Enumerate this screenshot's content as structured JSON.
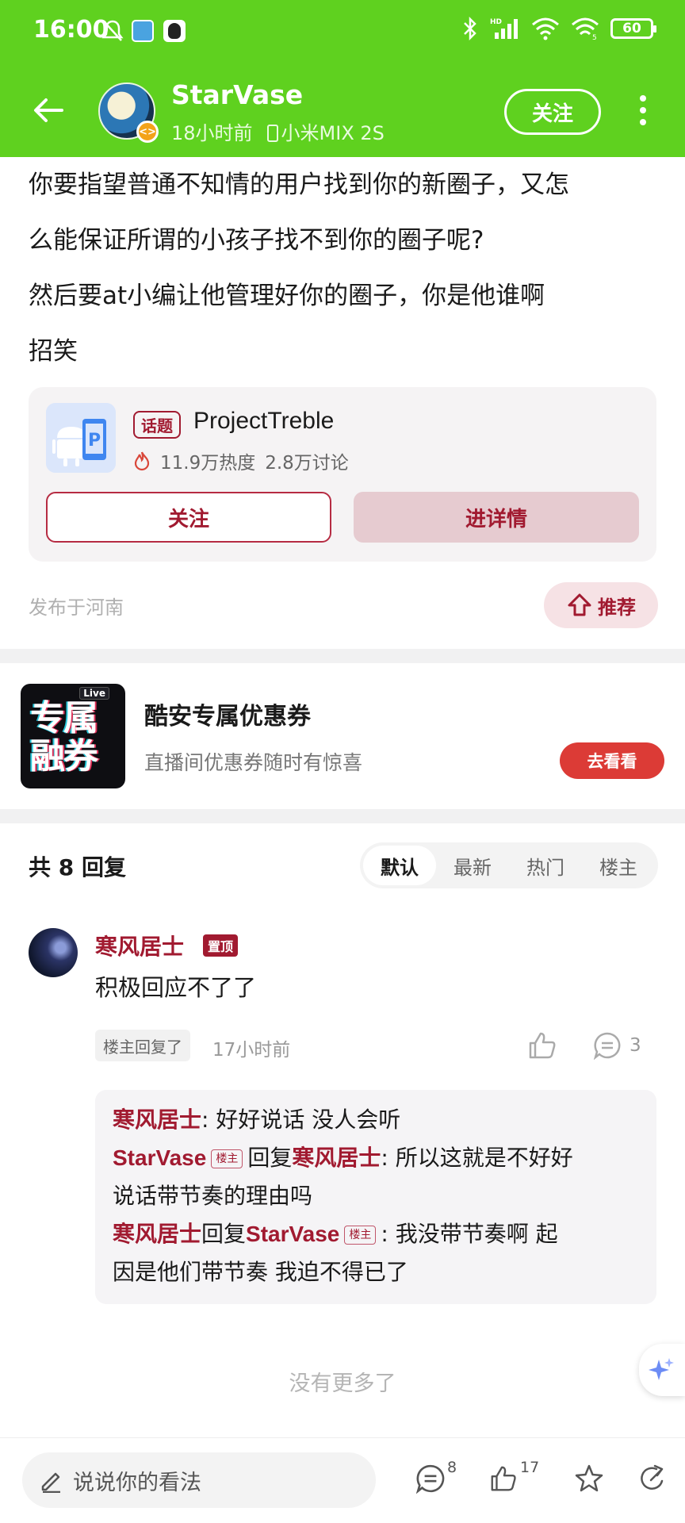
{
  "status_bar": {
    "time": "16:00",
    "battery": "60",
    "hd": "HD"
  },
  "header": {
    "username": "StarVase",
    "time_ago": "18小时前",
    "device": "小米MIX 2S",
    "follow_label": "关注"
  },
  "post": {
    "lines": [
      "你要指望普通不知情的用户找到你的新圈子，又怎",
      "么能保证所谓的小孩子找不到你的圈子呢?",
      "然后要at小编让他管理好你的圈子，你是他谁啊",
      "招笑"
    ]
  },
  "topic": {
    "tag": "话题",
    "title": "ProjectTreble",
    "heat": "11.9万热度",
    "discussions": "2.8万讨论",
    "follow_label": "关注",
    "detail_label": "进详情"
  },
  "publish_location": "发布于河南",
  "recommend_label": "推荐",
  "ad": {
    "image_text_1": "专属",
    "image_text_2": "融券",
    "live_tag": "Live",
    "title": "酷安专属优惠券",
    "subtitle": "直播间优惠券随时有惊喜",
    "button": "去看看"
  },
  "replies": {
    "count_label": "共 8 回复",
    "sort_tabs": [
      "默认",
      "最新",
      "热门",
      "楼主"
    ]
  },
  "comment": {
    "author": "寒风居士",
    "pin_tag": "置顶",
    "text": "积极回应不了了",
    "chip": "楼主回复了",
    "time": "17小时前",
    "reply_count": "3",
    "sub_replies": [
      {
        "author": "寒风居士",
        "text": ": 好好说话 没人会听"
      },
      {
        "author": "StarVase",
        "badge": "楼主",
        "reply_word": "回复",
        "target": "寒风居士",
        "text": ": 所以这就是不好好",
        "text_cont": "说话带节奏的理由吗"
      },
      {
        "author": "寒风居士",
        "reply_word": "回复",
        "target": "StarVase",
        "badge": "楼主",
        "text": ": 我没带节奏啊 起",
        "text_cont": "因是他们带节奏 我迫不得已了"
      }
    ]
  },
  "no_more": "没有更多了",
  "bottom_bar": {
    "input_placeholder": "说说你的看法",
    "comment_count": "8",
    "like_count": "17"
  },
  "colors": {
    "header_green": "#5fd11f",
    "accent_red": "#a11a30",
    "ad_button": "#dc3b36"
  }
}
